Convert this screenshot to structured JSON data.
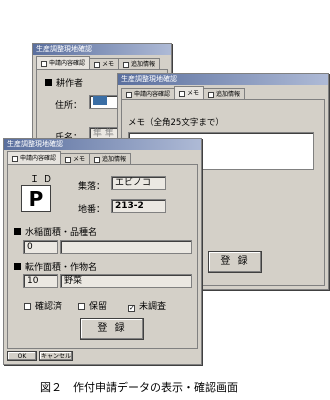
{
  "window_title": "生産調整現地確認",
  "tabs": {
    "application": "申請内容確認",
    "memo": "メモ",
    "extra": "追加情報"
  },
  "back_window": {
    "cultivator_heading": "耕作者",
    "address_label": "住所：",
    "name_label": "氏名：",
    "address_value": "",
    "name_value": "隼 隼"
  },
  "memo_window": {
    "memo_label": "メモ（全角25文字まで）",
    "memo_value": "",
    "register_button": "登 録"
  },
  "front_window": {
    "id_label": "ＩＤ",
    "id_value": "P",
    "settlement_label": "集落：",
    "settlement_value": "エビノコ",
    "lot_label": "地番：",
    "lot_value": "213-2",
    "paddy_heading": "水稲面積・品種名",
    "paddy_area": "0",
    "paddy_variety": "",
    "conversion_heading": "転作面積・作物名",
    "conversion_area": "10",
    "conversion_crop": "野菜",
    "check_confirmed": "確認済",
    "check_pending": "保留",
    "check_unchecked": "未調査",
    "checked_confirmed": "",
    "checked_pending": "",
    "checked_unchecked": "✓",
    "register_button": "登 録",
    "ok_button": "OK",
    "cancel_button": "キャンセル"
  },
  "caption": "図２　作付申請データの表示・確認画面",
  "colors": {
    "window_face": "#d4d0c8",
    "titlebar_start": "#5a6f9e",
    "titlebar_end": "#aebad6"
  }
}
